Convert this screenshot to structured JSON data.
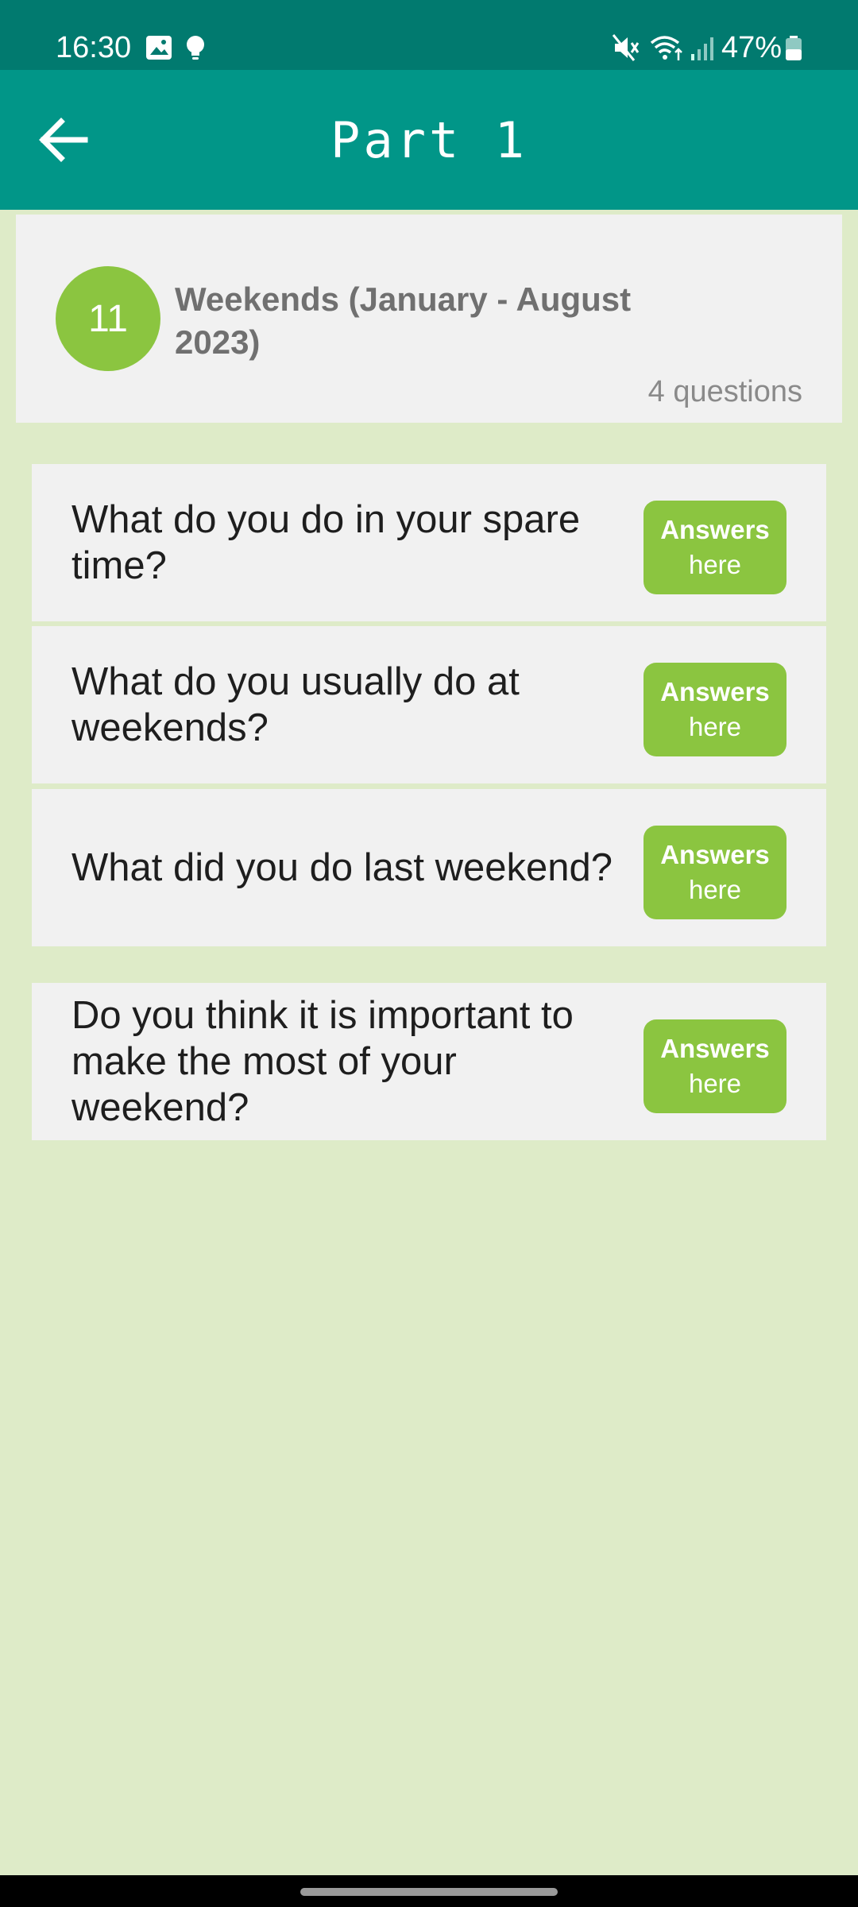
{
  "status_bar": {
    "time": "16:30",
    "battery_percent": "47%",
    "icons_left": [
      "image-icon",
      "bulb-icon"
    ],
    "icons_right": [
      "mute-icon",
      "wifi-icon",
      "signal-icon",
      "battery-icon"
    ]
  },
  "app_bar": {
    "title": "Part 1",
    "back_icon": "arrow-left-icon"
  },
  "topic": {
    "number": "11",
    "title": "Weekends (January - August 2023)",
    "count": "4 questions"
  },
  "questions": [
    {
      "text": "What do you do in your spare time?",
      "button_line1": "Answers",
      "button_line2": "here"
    },
    {
      "text": "What do you usually do at weekends?",
      "button_line1": "Answers",
      "button_line2": "here"
    },
    {
      "text": "What did you do last weekend?",
      "button_line1": "Answers",
      "button_line2": "here"
    },
    {
      "text": "Do you think it is important to make the most of your weekend?",
      "button_line1": "Answers",
      "button_line2": "here"
    }
  ],
  "colors": {
    "status_bar": "#017a6f",
    "app_bar": "#019688",
    "background": "#deebc8",
    "card": "#f1f1f1",
    "accent": "#8bc540"
  }
}
